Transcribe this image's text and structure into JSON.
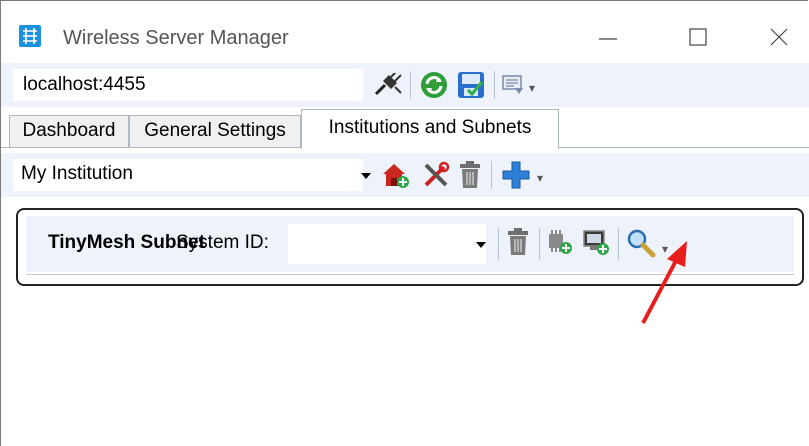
{
  "window": {
    "title": "Wireless Server Manager",
    "icon": "app-grid-icon",
    "controls": [
      "minimize-icon",
      "maximize-icon",
      "close-icon"
    ]
  },
  "server": {
    "address_value": "localhost:4455",
    "toolbar_icons": [
      "disconnect-plug-icon",
      "refresh-icon",
      "save-icon",
      "options-icon"
    ]
  },
  "tabs": [
    {
      "label": "Dashboard",
      "active": false
    },
    {
      "label": "General Settings",
      "active": false
    },
    {
      "label": "Institutions and Subnets",
      "active": true
    }
  ],
  "institution": {
    "selected": "My Institution",
    "toolbar_icons": [
      "add-institution-icon",
      "edit-tools-icon",
      "delete-icon",
      "add-subnet-icon"
    ]
  },
  "subnet": {
    "name": "TinyMesh Subnet",
    "system_id_label": "System ID:",
    "system_id_value": "",
    "toolbar_icons": [
      "delete-icon",
      "add-gateway-icon",
      "add-device-icon",
      "search-icon"
    ]
  },
  "annotation": {
    "arrow_color": "#e81e1e",
    "points_to": "search-icon"
  },
  "colors": {
    "toolbar_bg": "#eef2fa",
    "accent_blue": "#1e90e0",
    "arrow_red": "#e81e1e"
  }
}
